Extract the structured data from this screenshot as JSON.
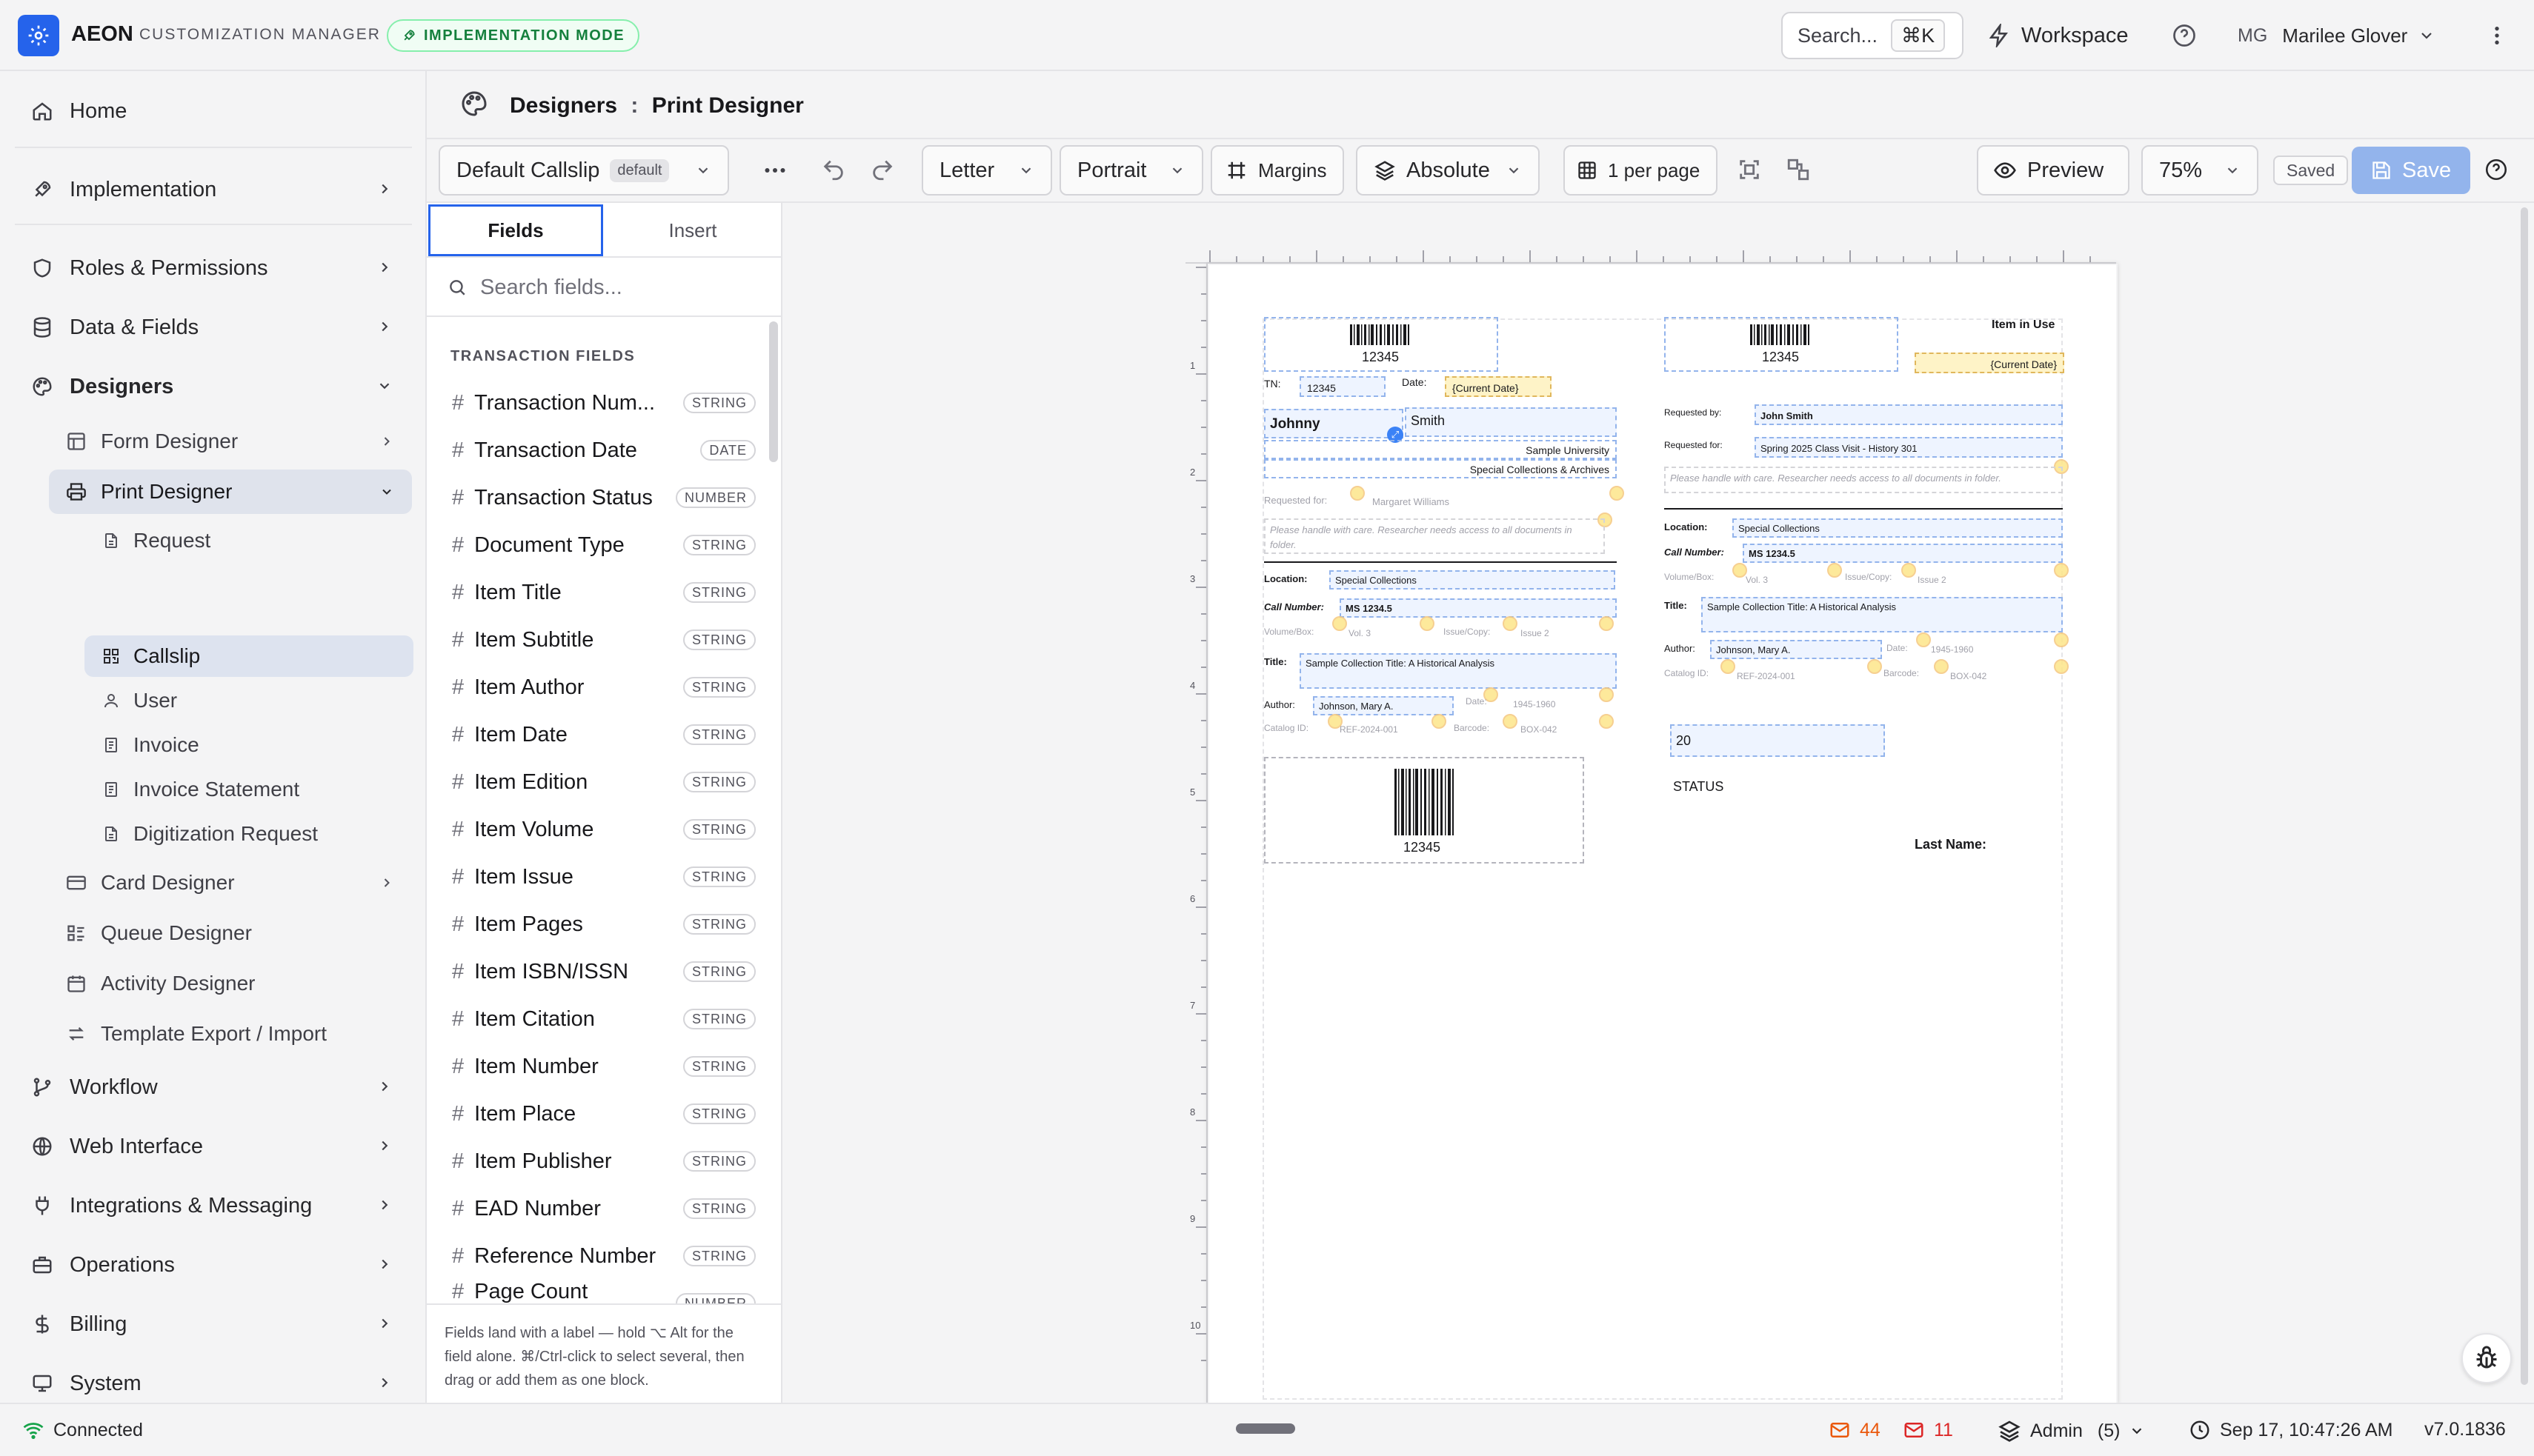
{
  "app": {
    "brand": "AEON",
    "subtitle": "CUSTOMIZATION MANAGER",
    "mode_badge": "IMPLEMENTATION MODE"
  },
  "topbar": {
    "search_label": "Search...",
    "search_shortcut": "⌘K",
    "workspace": "Workspace",
    "user_initials": "MG",
    "user_name": "Marilee Glover"
  },
  "sidebar": {
    "home": "Home",
    "implementation": "Implementation",
    "roles": "Roles & Permissions",
    "data_fields": "Data & Fields",
    "designers": "Designers",
    "form_designer": "Form Designer",
    "print_designer": "Print Designer",
    "print_children": [
      "Request",
      "Callslip",
      "User",
      "Invoice",
      "Invoice Statement",
      "Digitization Request"
    ],
    "card_designer": "Card Designer",
    "queue_designer": "Queue Designer",
    "activity_designer": "Activity Designer",
    "template_export": "Template Export / Import",
    "workflow": "Workflow",
    "web_interface": "Web Interface",
    "integrations": "Integrations & Messaging",
    "operations": "Operations",
    "billing": "Billing",
    "system": "System"
  },
  "breadcrumb": {
    "parent": "Designers",
    "sep": ":",
    "current": "Print Designer"
  },
  "toolbar": {
    "template": "Default Callslip",
    "template_badge": "default",
    "paper": "Letter",
    "orientation": "Portrait",
    "margins": "Margins",
    "layout": "Absolute",
    "per_page": "1 per page",
    "preview": "Preview",
    "zoom": "75%",
    "saved": "Saved",
    "save": "Save"
  },
  "fields_panel": {
    "tab_fields": "Fields",
    "tab_insert": "Insert",
    "search_placeholder": "Search fields...",
    "section": "TRANSACTION FIELDS",
    "items": [
      {
        "name": "Transaction Num...",
        "type": "STRING"
      },
      {
        "name": "Transaction Date",
        "type": "DATE"
      },
      {
        "name": "Transaction Status",
        "type": "NUMBER"
      },
      {
        "name": "Document Type",
        "type": "STRING"
      },
      {
        "name": "Item Title",
        "type": "STRING"
      },
      {
        "name": "Item Subtitle",
        "type": "STRING"
      },
      {
        "name": "Item Author",
        "type": "STRING"
      },
      {
        "name": "Item Date",
        "type": "STRING"
      },
      {
        "name": "Item Edition",
        "type": "STRING"
      },
      {
        "name": "Item Volume",
        "type": "STRING"
      },
      {
        "name": "Item Issue",
        "type": "STRING"
      },
      {
        "name": "Item Pages",
        "type": "STRING"
      },
      {
        "name": "Item ISBN/ISSN",
        "type": "STRING"
      },
      {
        "name": "Item Citation",
        "type": "STRING"
      },
      {
        "name": "Item Number",
        "type": "STRING"
      },
      {
        "name": "Item Place",
        "type": "STRING"
      },
      {
        "name": "Item Publisher",
        "type": "STRING"
      },
      {
        "name": "EAD Number",
        "type": "STRING"
      },
      {
        "name": "Reference Number",
        "type": "STRING"
      },
      {
        "name": "Page Count",
        "type": "NUMBER"
      }
    ],
    "hint": "Fields land with a label — hold ⌥ Alt for the field alone. ⌘/Ctrl-click to select several, then drag or add them as one block."
  },
  "ruler": {
    "marks": [
      "1",
      "2",
      "3",
      "4",
      "5",
      "6",
      "7",
      "8",
      "9",
      "10"
    ]
  },
  "slip": {
    "barcode_num": "12345",
    "tn_label": "TN:",
    "tn_value": "12345",
    "date_label": "Date:",
    "current_date": "{Current Date}",
    "first_name": "Johnny",
    "last_name": "Smith",
    "university": "Sample University",
    "dept": "Special Collections & Archives",
    "req_for_label": "Requested for:",
    "req_for_value": "Margaret Williams",
    "note": "Please handle with care. Researcher needs access to all documents in folder.",
    "location_label": "Location:",
    "location": "Special Collections",
    "call_label": "Call Number:",
    "call": "MS 1234.5",
    "volbox_label": "Volume/Box:",
    "vol": "Vol. 3",
    "issue_label": "Issue/Copy:",
    "issue": "Issue 2",
    "title_label": "Title:",
    "title": "Sample Collection Title: A Historical Analysis",
    "author_label": "Author:",
    "author": "Johnson, Mary A.",
    "date2_label": "Date:",
    "date2": "1945-1960",
    "catalog_label": "Catalog ID:",
    "catalog": "REF-2024-001",
    "barcode_label": "Barcode:",
    "barcode": "BOX-042",
    "item_in_use": "Item in Use",
    "req_by_label": "Requested by:",
    "req_by": "John Smith",
    "req_for2": "Spring 2025 Class Visit - History 301",
    "twenty": "20",
    "status": "STATUS",
    "last_name_label": "Last Name:"
  },
  "statusbar": {
    "connected": "Connected",
    "mail_count_1": "44",
    "mail_count_2": "11",
    "role": "Admin",
    "role_count": "(5)",
    "datetime": "Sep 17, 10:47:26 AM",
    "version": "v7.0.1836"
  }
}
